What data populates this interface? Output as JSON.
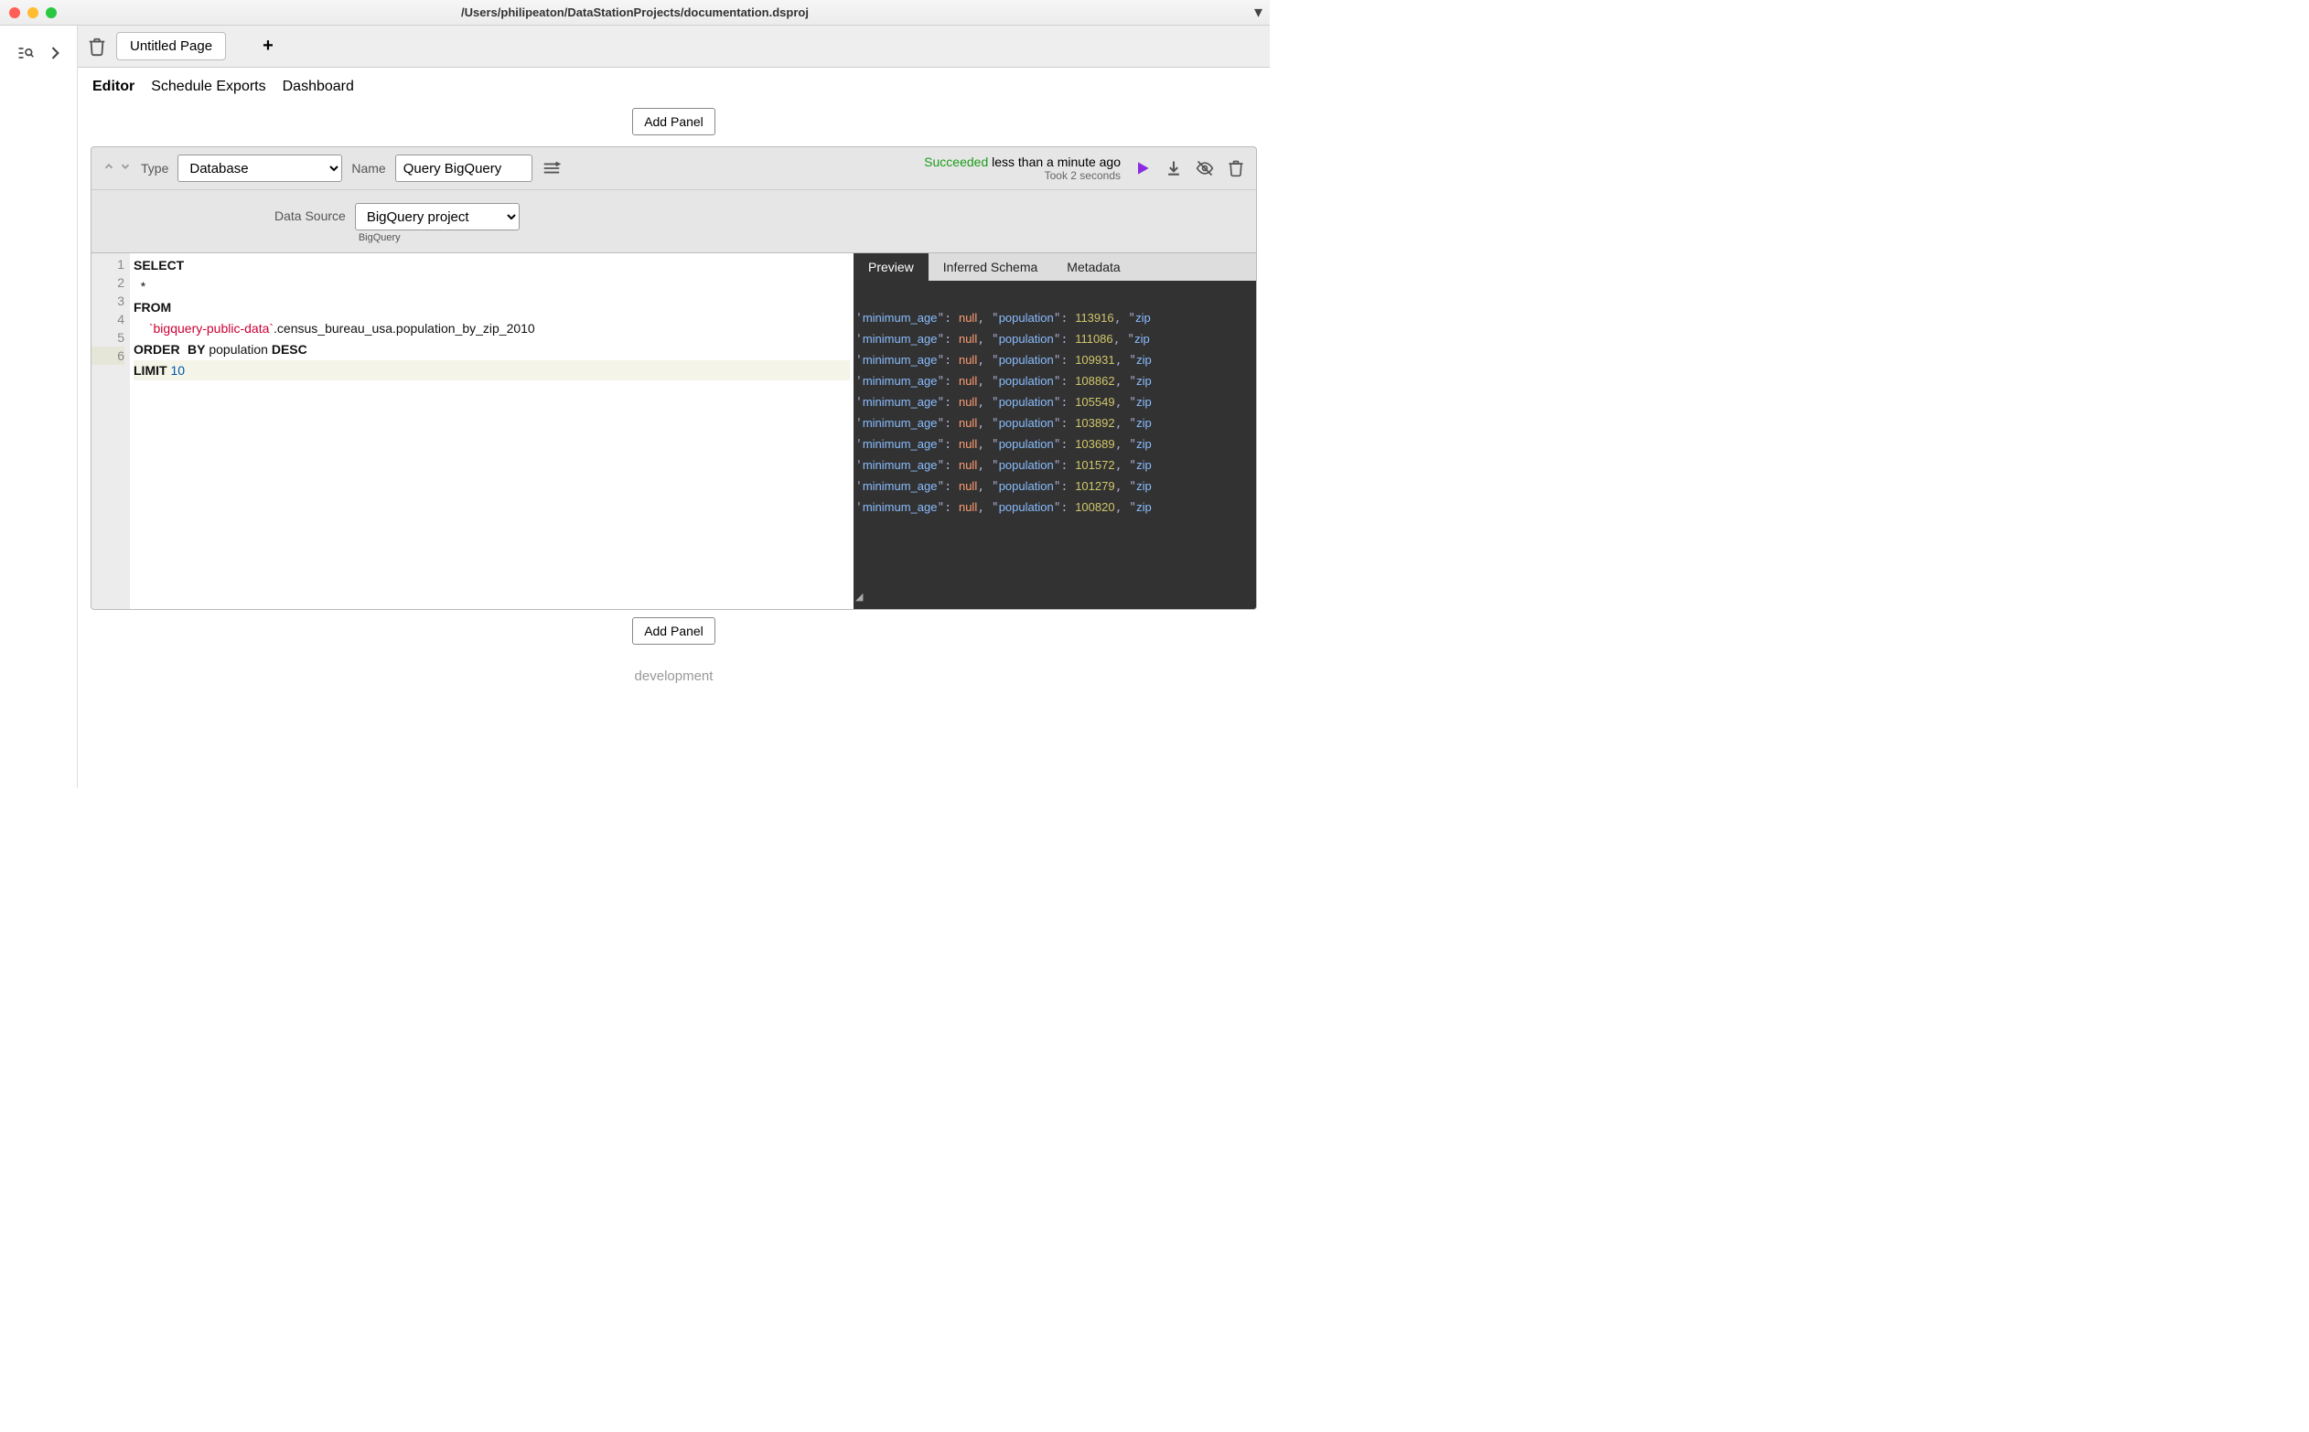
{
  "window": {
    "title": "/Users/philipeaton/DataStationProjects/documentation.dsproj"
  },
  "page_tab": {
    "name": "Untitled Page"
  },
  "view_tabs": {
    "editor": "Editor",
    "schedule": "Schedule Exports",
    "dashboard": "Dashboard",
    "active": "editor"
  },
  "buttons": {
    "add_panel": "Add Panel"
  },
  "panel": {
    "type_label": "Type",
    "type_value": "Database",
    "name_label": "Name",
    "name_value": "Query BigQuery",
    "status_ok": "Succeeded",
    "status_time": "less than a minute ago",
    "status_sub": "Took 2 seconds",
    "ds_label": "Data Source",
    "ds_value": "BigQuery project",
    "ds_sub": "BigQuery"
  },
  "code_lines": {
    "l1_kw": "SELECT",
    "l2": "  *",
    "l3_kw": "FROM",
    "l4_str": "`bigquery-public-data`",
    "l4_rest": ".census_bureau_usa.population_by_zip_2010",
    "l5_kw1": "ORDER",
    "l5_kw2": "BY",
    "l5_mid": " population ",
    "l5_kw3": "DESC",
    "l6_kw": "LIMIT",
    "l6_num": "10"
  },
  "line_numbers": [
    "1",
    "2",
    "3",
    "4",
    "5",
    "6"
  ],
  "preview_tabs": {
    "preview": "Preview",
    "schema": "Inferred Schema",
    "metadata": "Metadata"
  },
  "preview_rows": [
    {
      "pop": "113916"
    },
    {
      "pop": "111086"
    },
    {
      "pop": "109931"
    },
    {
      "pop": "108862"
    },
    {
      "pop": "105549"
    },
    {
      "pop": "103892"
    },
    {
      "pop": "103689"
    },
    {
      "pop": "101572"
    },
    {
      "pop": "101279"
    },
    {
      "pop": "100820"
    }
  ],
  "preview_keys": {
    "min_age": "minimum_age",
    "pop": "population",
    "zip": "zip",
    "null": "null"
  },
  "footer": {
    "dev": "development"
  }
}
